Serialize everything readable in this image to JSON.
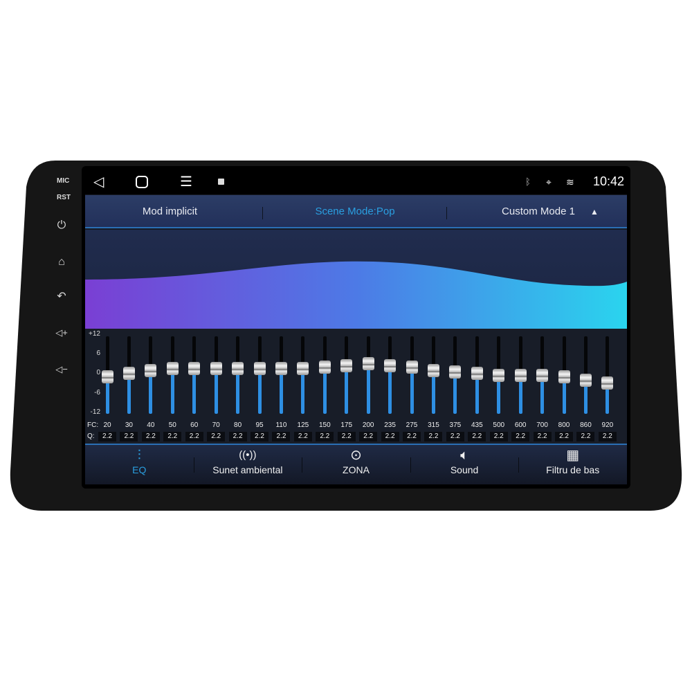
{
  "device": {
    "side_labels": [
      "MIC",
      "RST"
    ],
    "side_icons": [
      "power-icon",
      "home-icon",
      "back-icon",
      "volume-up-icon",
      "volume-down-icon"
    ]
  },
  "status_bar": {
    "time": "10:42",
    "icons": [
      "bluetooth-icon",
      "location-icon",
      "wifi-icon"
    ],
    "nav": [
      "back-icon",
      "home-icon",
      "menu-icon",
      "gallery-icon"
    ]
  },
  "header": {
    "left": "Mod implicit",
    "center": "Scene Mode:Pop",
    "right": "Custom Mode 1",
    "accent": "#2a9fe0"
  },
  "eq": {
    "axis": [
      "+12",
      "6",
      "0",
      "-6",
      "-12"
    ],
    "fc_label": "FC:",
    "q_label": "Q:",
    "range_db": [
      -12,
      12
    ],
    "bands": [
      {
        "fc": "20",
        "q": "2.2",
        "gain": -0.5
      },
      {
        "fc": "30",
        "q": "2.2",
        "gain": 0.5
      },
      {
        "fc": "40",
        "q": "2.2",
        "gain": 1.5
      },
      {
        "fc": "50",
        "q": "2.2",
        "gain": 2
      },
      {
        "fc": "60",
        "q": "2.2",
        "gain": 2
      },
      {
        "fc": "70",
        "q": "2.2",
        "gain": 2
      },
      {
        "fc": "80",
        "q": "2.2",
        "gain": 2
      },
      {
        "fc": "95",
        "q": "2.2",
        "gain": 2
      },
      {
        "fc": "110",
        "q": "2.2",
        "gain": 2
      },
      {
        "fc": "125",
        "q": "2.2",
        "gain": 2
      },
      {
        "fc": "150",
        "q": "2.2",
        "gain": 2.5
      },
      {
        "fc": "175",
        "q": "2.2",
        "gain": 3
      },
      {
        "fc": "200",
        "q": "2.2",
        "gain": 3.5
      },
      {
        "fc": "235",
        "q": "2.2",
        "gain": 3
      },
      {
        "fc": "275",
        "q": "2.2",
        "gain": 2.5
      },
      {
        "fc": "315",
        "q": "2.2",
        "gain": 1.5
      },
      {
        "fc": "375",
        "q": "2.2",
        "gain": 1
      },
      {
        "fc": "435",
        "q": "2.2",
        "gain": 0.5
      },
      {
        "fc": "500",
        "q": "2.2",
        "gain": 0
      },
      {
        "fc": "600",
        "q": "2.2",
        "gain": 0
      },
      {
        "fc": "700",
        "q": "2.2",
        "gain": 0
      },
      {
        "fc": "800",
        "q": "2.2",
        "gain": -0.5
      },
      {
        "fc": "860",
        "q": "2.2",
        "gain": -1.5
      },
      {
        "fc": "920",
        "q": "2.2",
        "gain": -2.5
      }
    ]
  },
  "tabs": [
    {
      "label": "EQ",
      "icon": "equalizer-icon",
      "active": true
    },
    {
      "label": "Sunet ambiental",
      "icon": "surround-icon"
    },
    {
      "label": "ZONA",
      "icon": "zone-target-icon"
    },
    {
      "label": "Sound",
      "icon": "speaker-icon"
    },
    {
      "label": "Filtru de bas",
      "icon": "bass-filter-icon"
    }
  ]
}
